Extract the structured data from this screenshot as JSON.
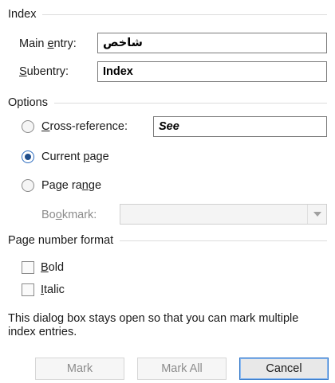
{
  "index_group": {
    "title": "Index",
    "main_entry_label": "Main entry:",
    "main_entry_value": "شاخص",
    "subentry_label": "Subentry:",
    "subentry_value": "Index"
  },
  "options_group": {
    "title": "Options",
    "cross_reference_label": "Cross-reference:",
    "cross_reference_value": "See",
    "current_page_label": "Current page",
    "page_range_label": "Page range",
    "bookmark_label": "Bookmark:",
    "bookmark_value": "",
    "selected_option": "current_page"
  },
  "page_number_format_group": {
    "title": "Page number format",
    "bold_label": "Bold",
    "bold_checked": false,
    "italic_label": "Italic",
    "italic_checked": false
  },
  "info_text": "This dialog box stays open so that you can mark multiple index entries.",
  "buttons": {
    "mark": "Mark",
    "mark_all": "Mark All",
    "cancel": "Cancel"
  },
  "icons": {
    "dropdown": "chevron-down-icon"
  },
  "colors": {
    "accent": "#2e75c8",
    "radio_fill": "#1f4e8c",
    "disabled_text": "#8c8c8c"
  }
}
